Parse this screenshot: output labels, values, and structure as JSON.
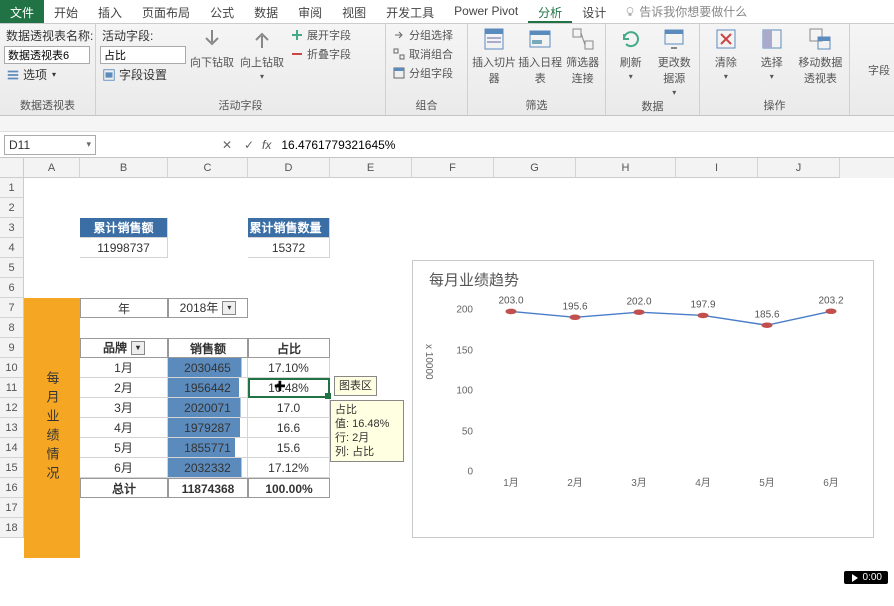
{
  "tabs": {
    "file": "文件",
    "start": "开始",
    "insert": "插入",
    "layout": "页面布局",
    "formula": "公式",
    "data": "数据",
    "review": "审阅",
    "view": "视图",
    "dev": "开发工具",
    "pp": "Power Pivot",
    "analyze": "分析",
    "design": "设计",
    "tellme": "告诉我你想要做什么"
  },
  "ribbon": {
    "pv_name_label": "数据透视表名称:",
    "pv_name_value": "数据透视表6",
    "options": "选项",
    "af_label": "活动字段:",
    "af_value": "占比",
    "field_settings": "字段设置",
    "drill_down": "向下钻取",
    "drill_up": "向上钻取",
    "expand_field": "展开字段",
    "collapse_field": "折叠字段",
    "sel_group": "分组选择",
    "ungroup": "取消组合",
    "group_field": "分组字段",
    "slicer": "插入切片器",
    "timeline": "插入日程表",
    "filter_conn": "筛选器连接",
    "refresh": "刷新",
    "change_src": "更改数据源",
    "clear": "清除",
    "select": "选择",
    "move": "移动数据透视表",
    "field_tail": "字段",
    "g1": "数据透视表",
    "g2": "活动字段",
    "g3": "组合",
    "g4": "筛选",
    "g5": "数据",
    "g6": "操作"
  },
  "fbar": {
    "cellref": "D11",
    "value": "16.4761779321645%"
  },
  "columns": [
    "A",
    "B",
    "C",
    "D",
    "E",
    "F",
    "G",
    "H",
    "I",
    "J"
  ],
  "sheet": {
    "sum_sales_label": "累计销售额",
    "sum_sales": "11998737",
    "sum_qty_label": "累计销售数量",
    "sum_qty": "15372",
    "year_label": "年",
    "year_value": "2018年",
    "brand_hdr": "品牌",
    "sales_hdr": "销售额",
    "pct_hdr": "占比",
    "vtitle": "每月业绩情况",
    "total_label": "总计",
    "total_sales": "11874368",
    "total_pct": "100.00%",
    "rows": [
      {
        "m": "1月",
        "s": "2030465",
        "p": "17.10%",
        "bar": 93
      },
      {
        "m": "2月",
        "s": "1956442",
        "p": "16.48%",
        "bar": 90
      },
      {
        "m": "3月",
        "s": "2020071",
        "p": "17.0",
        "bar": 92
      },
      {
        "m": "4月",
        "s": "1979287",
        "p": "16.6",
        "bar": 91
      },
      {
        "m": "5月",
        "s": "1855771",
        "p": "15.6",
        "bar": 85
      },
      {
        "m": "6月",
        "s": "2032332",
        "p": "17.12%",
        "bar": 93
      }
    ],
    "tooltip": {
      "area": "图表区",
      "f": "占比",
      "v": "值: 16.48%",
      "r": "行: 2月",
      "c": "列: 占比"
    }
  },
  "chart_data": {
    "type": "line",
    "title": "每月业绩趋势",
    "ylabel": "x 10000",
    "categories": [
      "1月",
      "2月",
      "3月",
      "4月",
      "5月",
      "6月"
    ],
    "values": [
      203.0,
      195.6,
      202.0,
      197.9,
      185.6,
      203.2
    ],
    "yticks": [
      0,
      50,
      100,
      150,
      200
    ],
    "ylim": [
      0,
      220
    ]
  },
  "video_badge": "0:00"
}
